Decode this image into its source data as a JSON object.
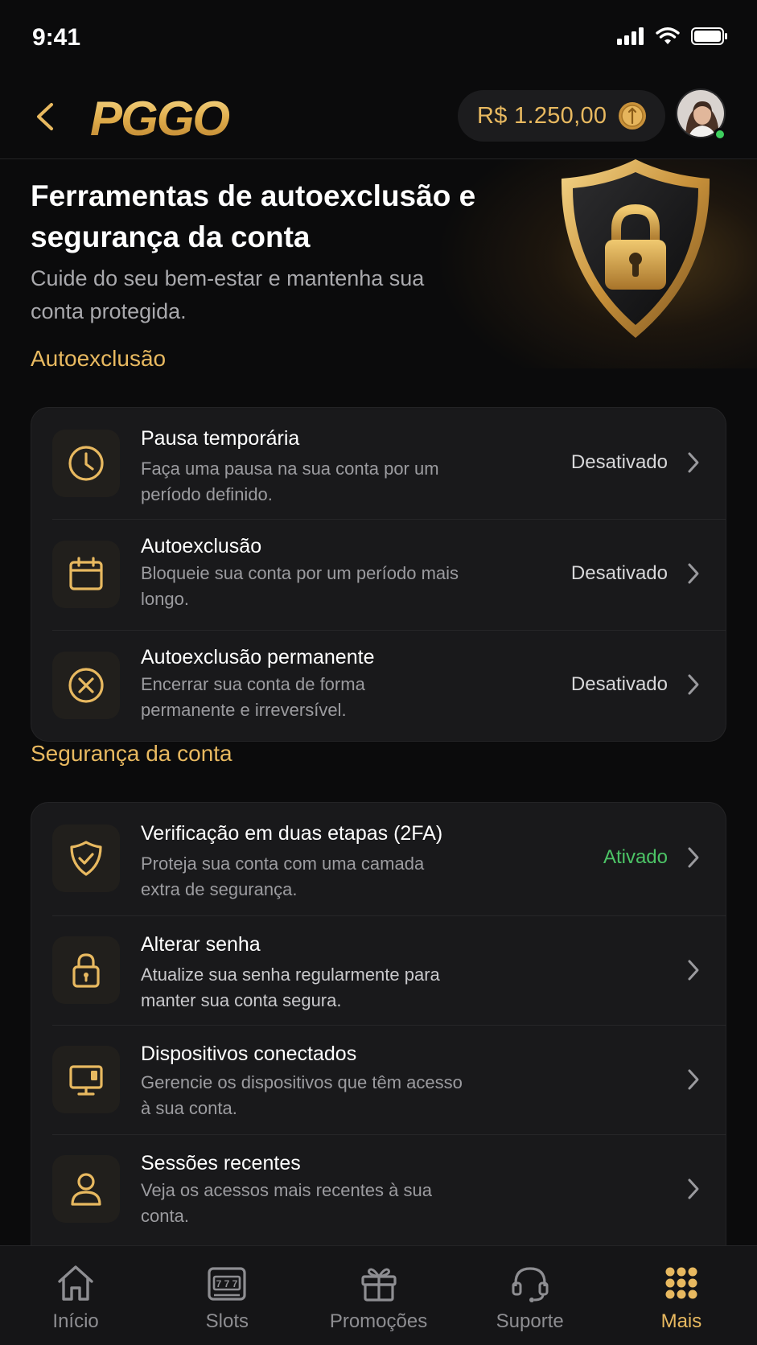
{
  "status_bar": {
    "time": "9:41"
  },
  "header": {
    "brand": "PGGO",
    "balance": "R$ 1.250,00"
  },
  "hero": {
    "title": "Ferramentas de autoexclusão e segurança da conta",
    "subtitle": "Cuide do seu bem-estar e mantenha sua conta protegida."
  },
  "sections": {
    "self_exclusion": {
      "title": "Autoexclusão",
      "items": [
        {
          "icon": "clock-icon",
          "title": "Pausa temporária",
          "desc": "Faça uma pausa na sua conta por um período definido.",
          "status": "Desativado"
        },
        {
          "icon": "calendar-icon",
          "title": "Autoexclusão",
          "desc": "Bloqueie sua conta por um período mais longo.",
          "status": "Desativado"
        },
        {
          "icon": "x-circle-icon",
          "title": "Autoexclusão permanente",
          "desc": "Encerrar sua conta de forma permanente e irreversível.",
          "status": "Desativado"
        }
      ]
    },
    "security": {
      "title": "Segurança da conta",
      "items": [
        {
          "icon": "shield-check-icon",
          "title": "Verificação em duas etapas (2FA)",
          "desc": "Proteja sua conta com uma camada extra de segurança.",
          "status": "Ativado"
        },
        {
          "icon": "lock-icon",
          "title": "Alterar senha",
          "desc": "Atualize sua senha regularmente para manter sua conta segura.",
          "status": ""
        },
        {
          "icon": "monitor-icon",
          "title": "Dispositivos conectados",
          "desc": "Gerencie os dispositivos que têm acesso à sua conta.",
          "status": ""
        },
        {
          "icon": "user-icon",
          "title": "Sessões recentes",
          "desc": "Veja os acessos mais recentes à sua conta.",
          "status": ""
        }
      ]
    }
  },
  "bottom_nav": [
    {
      "label": "Início",
      "icon": "home-icon"
    },
    {
      "label": "Slots",
      "icon": "slot-machine-icon"
    },
    {
      "label": "Promoções",
      "icon": "gift-icon"
    },
    {
      "label": "Suporte",
      "icon": "headset-icon"
    },
    {
      "label": "Mais",
      "icon": "grid-dots-icon",
      "active": true
    }
  ],
  "colors": {
    "accent": "#e8b960",
    "active_status": "#4cc466",
    "background": "#0b0b0c",
    "card": "#19191b"
  }
}
